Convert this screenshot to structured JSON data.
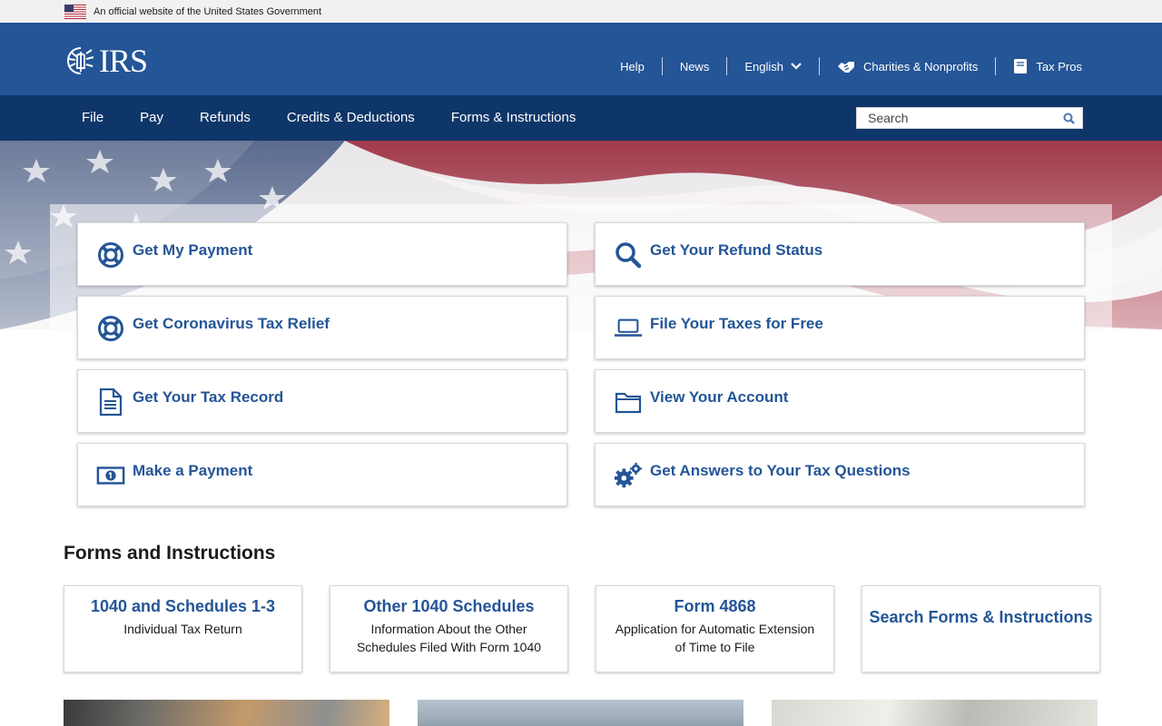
{
  "gov_banner": {
    "text": "An official website of the United States Government"
  },
  "header": {
    "logo_text": "IRS",
    "utility_nav": [
      {
        "label": "Help"
      },
      {
        "label": "News"
      },
      {
        "label": "English"
      },
      {
        "label": "Charities & Nonprofits",
        "icon": "handshake-icon"
      },
      {
        "label": "Tax Pros",
        "icon": "book-icon"
      }
    ]
  },
  "main_nav": {
    "items": [
      {
        "label": "File"
      },
      {
        "label": "Pay"
      },
      {
        "label": "Refunds"
      },
      {
        "label": "Credits & Deductions"
      },
      {
        "label": "Forms & Instructions"
      }
    ],
    "search_placeholder": "Search"
  },
  "quick_links": [
    {
      "label": "Get My Payment",
      "icon": "lifebuoy-icon"
    },
    {
      "label": "Get Your Refund Status",
      "icon": "magnifier-icon"
    },
    {
      "label": "Get Coronavirus Tax Relief",
      "icon": "lifebuoy-icon"
    },
    {
      "label": "File Your Taxes for Free",
      "icon": "laptop-icon"
    },
    {
      "label": "Get Your Tax Record",
      "icon": "document-icon"
    },
    {
      "label": "View Your Account",
      "icon": "folder-icon"
    },
    {
      "label": "Make a Payment",
      "icon": "money-icon"
    },
    {
      "label": "Get Answers to Your Tax Questions",
      "icon": "gears-icon"
    }
  ],
  "forms_section": {
    "title": "Forms and Instructions",
    "cards": [
      {
        "title": "1040 and Schedules 1-3",
        "description": "Individual Tax Return"
      },
      {
        "title": "Other 1040 Schedules",
        "description": "Information About the Other Schedules Filed With Form 1040"
      },
      {
        "title": "Form 4868",
        "description": "Application for Automatic Extension of Time to File"
      },
      {
        "title": "Search Forms & Instructions",
        "description": ""
      }
    ]
  },
  "colors": {
    "header_blue": "#245597",
    "nav_navy": "#0f3669",
    "link_blue": "#245597"
  }
}
